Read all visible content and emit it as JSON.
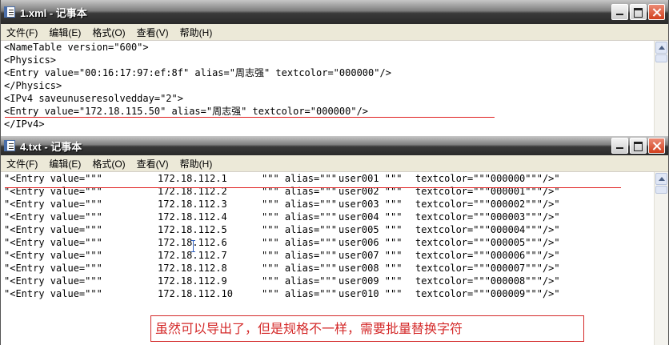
{
  "window1": {
    "title": "1.xml - 记事本",
    "menu": [
      "文件(F)",
      "编辑(E)",
      "格式(O)",
      "查看(V)",
      "帮助(H)"
    ],
    "lines": [
      "<NameTable version=\"600\">",
      "<Physics>",
      "<Entry value=\"00:16:17:97:ef:8f\" alias=\"周志强\" textcolor=\"000000\"/>",
      "</Physics>",
      "<IPv4 saveunuseresolvedday=\"2\">",
      "<Entry value=\"172.18.115.50\" alias=\"周志强\" textcolor=\"000000\"/>",
      "</IPv4>"
    ]
  },
  "window2": {
    "title": "4.txt - 记事本",
    "menu": [
      "文件(F)",
      "编辑(E)",
      "格式(O)",
      "查看(V)",
      "帮助(H)"
    ],
    "rows": [
      [
        "\"<Entry value=\"\"\"",
        "172.18.112.1",
        "\"\"\" alias=\"\"\"",
        "user001 \"\"\"",
        "textcolor=\"\"\"000000\"\"\"/>\""
      ],
      [
        "\"<Entry value=\"\"\"",
        "172.18.112.2",
        "\"\"\" alias=\"\"\"",
        "user002 \"\"\"",
        "textcolor=\"\"\"000001\"\"\"/>\""
      ],
      [
        "\"<Entry value=\"\"\"",
        "172.18.112.3",
        "\"\"\" alias=\"\"\"",
        "user003 \"\"\"",
        "textcolor=\"\"\"000002\"\"\"/>\""
      ],
      [
        "\"<Entry value=\"\"\"",
        "172.18.112.4",
        "\"\"\" alias=\"\"\"",
        "user004 \"\"\"",
        "textcolor=\"\"\"000003\"\"\"/>\""
      ],
      [
        "\"<Entry value=\"\"\"",
        "172.18.112.5",
        "\"\"\" alias=\"\"\"",
        "user005 \"\"\"",
        "textcolor=\"\"\"000004\"\"\"/>\""
      ],
      [
        "\"<Entry value=\"\"\"",
        "172.18.112.6",
        "\"\"\" alias=\"\"\"",
        "user006 \"\"\"",
        "textcolor=\"\"\"000005\"\"\"/>\""
      ],
      [
        "\"<Entry value=\"\"\"",
        "172.18.112.7",
        "\"\"\" alias=\"\"\"",
        "user007 \"\"\"",
        "textcolor=\"\"\"000006\"\"\"/>\""
      ],
      [
        "\"<Entry value=\"\"\"",
        "172.18.112.8",
        "\"\"\" alias=\"\"\"",
        "user008 \"\"\"",
        "textcolor=\"\"\"000007\"\"\"/>\""
      ],
      [
        "\"<Entry value=\"\"\"",
        "172.18.112.9",
        "\"\"\" alias=\"\"\"",
        "user009 \"\"\"",
        "textcolor=\"\"\"000008\"\"\"/>\""
      ],
      [
        "\"<Entry value=\"\"\"",
        "172.18.112.10",
        "\"\"\" alias=\"\"\"",
        "user010 \"\"\"",
        "textcolor=\"\"\"000009\"\"\"/>\""
      ]
    ]
  },
  "annotation": "虽然可以导出了，但是规格不一样，需要批量替换字符",
  "colors": {
    "annotation_red": "#d42a2a",
    "underline_red": "#e02020",
    "menubar_bg": "#ece9d8"
  }
}
